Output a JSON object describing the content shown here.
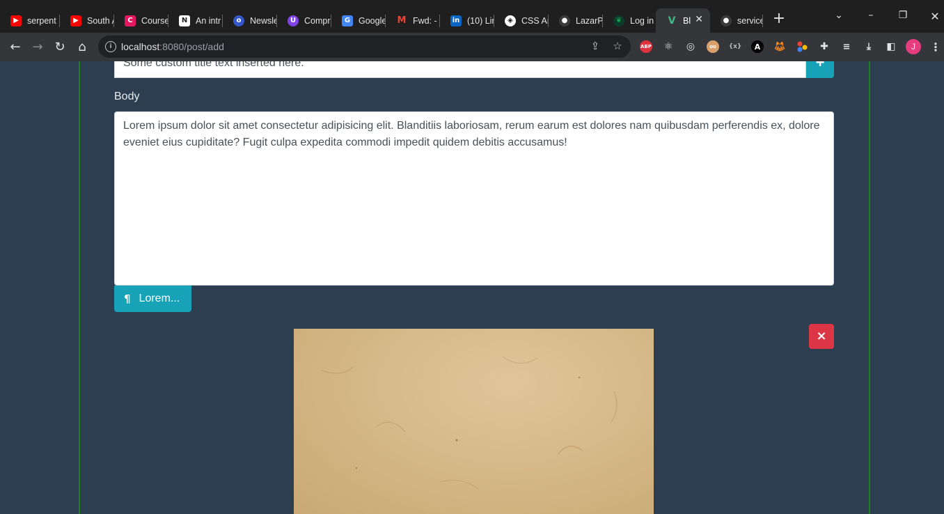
{
  "browser": {
    "tabs": [
      {
        "title": "serpent",
        "icon": "youtube-icon",
        "color": "#ff0000"
      },
      {
        "title": "South A",
        "icon": "youtube-icon",
        "color": "#ff0000"
      },
      {
        "title": "Course",
        "icon": "coursera-icon",
        "color": "#e2175f"
      },
      {
        "title": "An intr",
        "icon": "document-icon",
        "color": "#ffffff"
      },
      {
        "title": "Newsle",
        "icon": "newsletter-icon",
        "color": "#3558c9"
      },
      {
        "title": "Compr",
        "icon": "u-logo-icon",
        "color": "#8043e6"
      },
      {
        "title": "Google",
        "icon": "google-translate-icon",
        "color": "#4285f4"
      },
      {
        "title": "Fwd: - ",
        "icon": "gmail-icon",
        "color": "#ea4335"
      },
      {
        "title": "(10) Lin",
        "icon": "linkedin-icon",
        "color": "#0a66c2"
      },
      {
        "title": "CSS An",
        "icon": "codepen-icon",
        "color": "#ffffff"
      },
      {
        "title": "LazarP",
        "icon": "github-icon",
        "color": "#24292f"
      },
      {
        "title": "Log in",
        "icon": "mongodb-leaf-icon",
        "color": "#13aa52"
      },
      {
        "title": "Bl",
        "icon": "vue-icon",
        "color": "#41b883",
        "active": true
      },
      {
        "title": "service",
        "icon": "github-icon",
        "color": "#24292f"
      }
    ],
    "url_host": "localhost",
    "url_rest": ":8080/post/add"
  },
  "form": {
    "title_value": "Some custom title text inserted here.",
    "add_label": "+",
    "body_label": "Body",
    "body_value": "Lorem ipsum dolor sit amet consectetur adipisicing elit. Blanditiis laboriosam, rerum earum est dolores nam quibusdam perferendis ex, dolore eveniet eius cupiditate? Fugit culpa expedita commodi impedit quidem debitis accusamus!",
    "lorem_label": "Lorem...",
    "remove_label": "×"
  },
  "colors": {
    "page_bg": "#2c3e50",
    "accent": "#17a2b8",
    "danger": "#dc3545",
    "border_green": "#1e7e1e"
  }
}
